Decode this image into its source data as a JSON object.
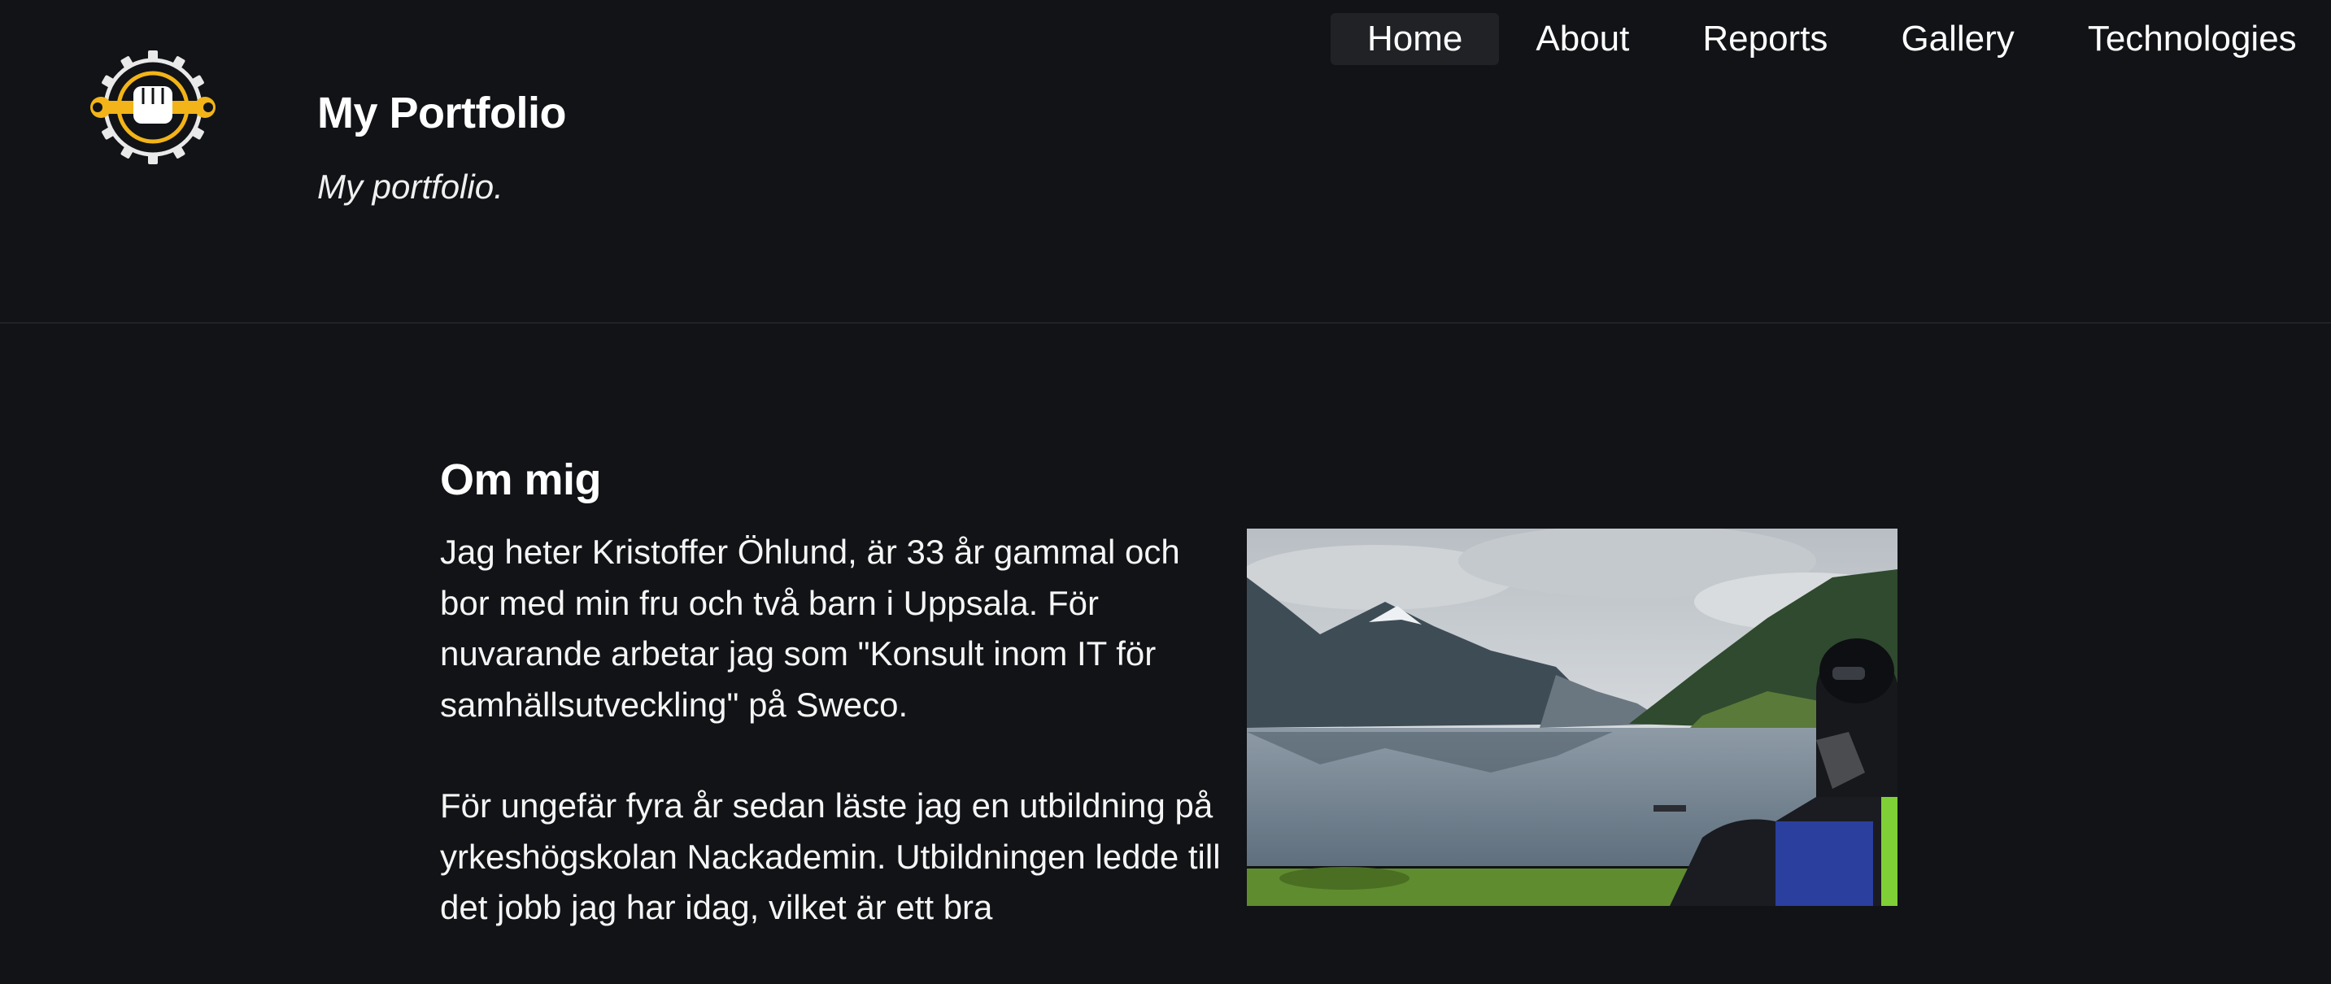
{
  "site": {
    "title": "My Portfolio",
    "subtitle": "My portfolio."
  },
  "nav": {
    "items": [
      {
        "label": "Home",
        "active": true
      },
      {
        "label": "About",
        "active": false
      },
      {
        "label": "Reports",
        "active": false
      },
      {
        "label": "Gallery",
        "active": false
      },
      {
        "label": "Technologies",
        "active": false
      }
    ]
  },
  "about": {
    "heading": "Om mig",
    "paragraphs": [
      "Jag heter Kristoffer Öhlund, är 33 år gammal och bor med min fru och två barn i Uppsala. För nuvarande arbetar jag som \"Konsult inom IT för samhällsutveckling\" på Sweco.",
      "För ungefär fyra år sedan läste jag en utbildning på yrkeshögskolan Nackademin. Utbildningen ledde till det jobb jag har idag, vilket är ett bra"
    ]
  },
  "icons": {
    "logo": "gear-fist-wrench-logo-icon",
    "photo": "motorcycle-rider-by-fjord-photo"
  },
  "colors": {
    "background": "#111316",
    "accent": "#f2b418",
    "nav_active_bg": "#202225"
  }
}
